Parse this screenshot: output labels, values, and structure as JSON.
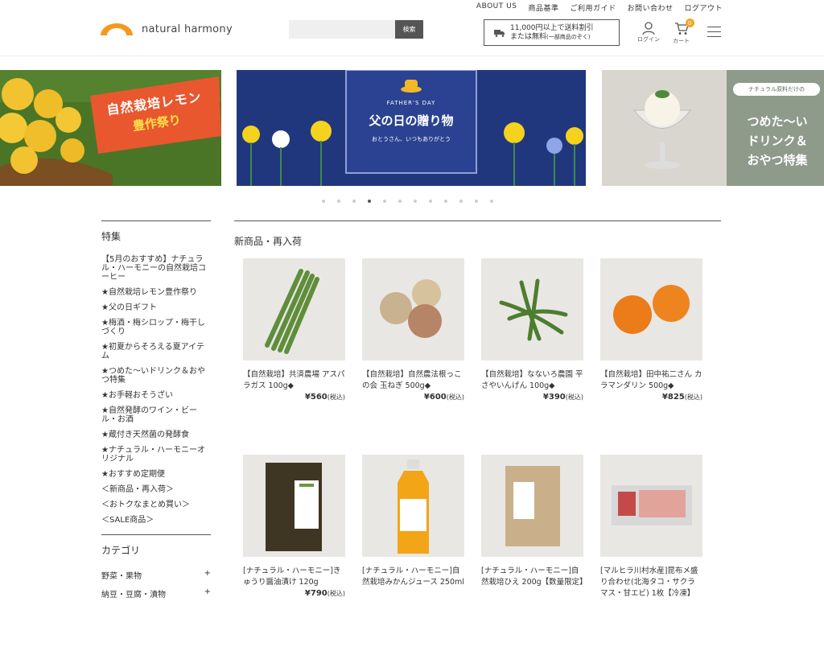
{
  "header": {
    "topnav": [
      "ABOUT US",
      "商品基準",
      "ご利用ガイド",
      "お問い合わせ",
      "ログアウト"
    ],
    "logo_text": "natural harmony",
    "search": {
      "placeholder": "",
      "button": "検索"
    },
    "shipping_line1": "11,000円以上で送料割引",
    "shipping_line2": "または無料",
    "shipping_note": "(一部商品のぞく)",
    "login_label": "ログイン",
    "cart_label": "カート",
    "cart_count": "0"
  },
  "banners": {
    "lemon_line1": "自然栽培レモン",
    "lemon_line2": "豊作祭り",
    "fathers_en": "FATHER'S DAY",
    "fathers_title": "父の日の贈り物",
    "fathers_sub": "おとうさん、いつもありがとう",
    "drink_tag": "ナチュラル原料だけの",
    "drink_line1": "つめた〜い",
    "drink_line2": "ドリンク＆",
    "drink_line3": "おやつ特集"
  },
  "carousel": {
    "count": 12,
    "active": 3
  },
  "sidebar": {
    "feature_heading": "特集",
    "features": [
      "【5月のおすすめ】ナチュラル・ハーモニーの自然栽培コーヒー",
      "★自然栽培レモン豊作祭り",
      "★父の日ギフト",
      "★梅酒・梅シロップ・梅干しづくり",
      "★初夏からそろえる夏アイテム",
      "★つめた〜いドリンク＆おやつ特集",
      "★お手軽おそうざい",
      "★自然発酵のワイン・ビール・お酒",
      "★蔵付き天然菌の発酵食",
      "★ナチュラル・ハーモニーオリジナル",
      "★おすすめ定期便",
      "＜新商品・再入荷＞",
      "＜おトクなまとめ買い＞",
      "＜SALE商品＞"
    ],
    "category_heading": "カテゴリ",
    "categories": [
      "野菜・果物",
      "納豆・豆腐・漬物"
    ]
  },
  "main": {
    "heading": "新商品・再入荷",
    "products": [
      {
        "name": "【自然栽培】共済農場 アスパラガス 100g◆",
        "price": "¥560",
        "tax": "(税込)",
        "icon": "asparagus"
      },
      {
        "name": "【自然栽培】自然農法根っこの会 玉ねぎ 500g◆",
        "price": "¥600",
        "tax": "(税込)",
        "icon": "onion"
      },
      {
        "name": "【自然栽培】なないろ農園 平さやいんげん 100g◆",
        "price": "¥390",
        "tax": "(税込)",
        "icon": "green-beans"
      },
      {
        "name": "【自然栽培】田中祐二さん カラマンダリン 500g◆",
        "price": "¥825",
        "tax": "(税込)",
        "icon": "mandarin"
      },
      {
        "name": "[ナチュラル・ハーモニー]きゅうり醤油漬け 120g",
        "price": "¥790",
        "tax": "(税込)",
        "icon": "pickles-pack"
      },
      {
        "name": "[ナチュラル・ハーモニー]自然栽培みかんジュース 250ml",
        "price": "",
        "tax": "",
        "icon": "juice-bottle"
      },
      {
        "name": "[ナチュラル・ハーモニー]自然栽培ひえ 200g【数量限定】",
        "price": "",
        "tax": "",
        "icon": "millet-pack"
      },
      {
        "name": "[マルヒラ川村水産]昆布メ盛り合わせ(北海タコ・サクラマス・甘エビ) 1枚【冷凍】",
        "price": "",
        "tax": "",
        "icon": "seafood-pack"
      }
    ]
  },
  "colors": {
    "accent": "#f39a1e",
    "navy": "#21377d",
    "dark": "#555555"
  }
}
